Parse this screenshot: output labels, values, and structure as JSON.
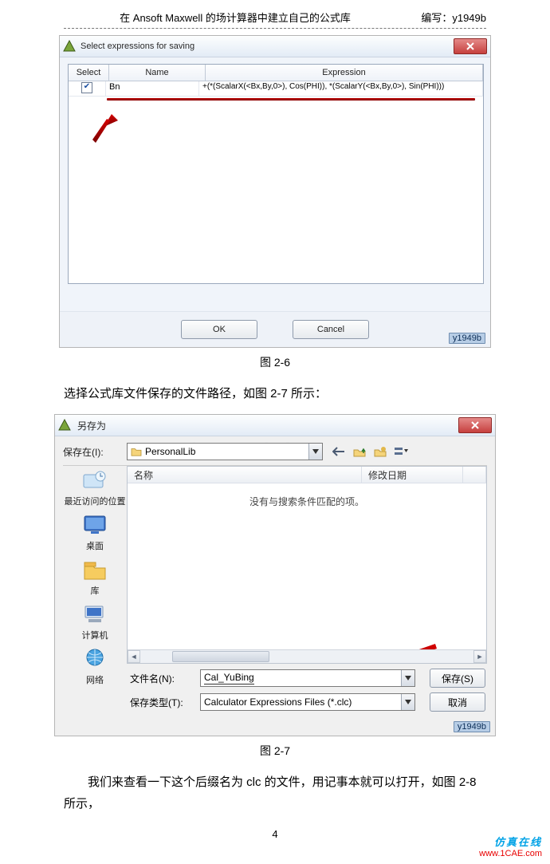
{
  "header": {
    "title": "在 Ansoft Maxwell 的场计算器中建立自己的公式库",
    "author_prefix": "编写：",
    "author": "y1949b"
  },
  "paragraphs": {
    "p1": "选择公式库文件保存的文件路径，如图 2-7 所示：",
    "p2": "我们来查看一下这个后缀名为 clc 的文件，用记事本就可以打开，如图 2-8 所示，"
  },
  "captions": {
    "fig26": "图 2-6",
    "fig27": "图 2-7"
  },
  "pagenum": "4",
  "footer": {
    "brand": "仿真在线",
    "url": "www.1CAE.com"
  },
  "watermark_faint": "1CAE.COM",
  "dialog1": {
    "title": "Select expressions for saving",
    "columns": {
      "select": "Select",
      "name": "Name",
      "expression": "Expression"
    },
    "row": {
      "checked": "✔",
      "name": "Bn",
      "expression": "+(*(ScalarX(<Bx,By,0>), Cos(PHI)), *(ScalarY(<Bx,By,0>), Sin(PHI)))"
    },
    "buttons": {
      "ok": "OK",
      "cancel": "Cancel"
    },
    "watermark": "y1949b"
  },
  "dialog2": {
    "title": "另存为",
    "save_in_label": "保存在(I):",
    "folder": "PersonalLib",
    "columns": {
      "name": "名称",
      "date": "修改日期"
    },
    "empty": "没有与搜索条件匹配的项。",
    "places": {
      "recent": "最近访问的位置",
      "desktop": "桌面",
      "library": "库",
      "computer": "计算机",
      "network": "网络"
    },
    "filename_label": "文件名(N):",
    "filename_value": "Cal_YuBing",
    "filetype_label": "保存类型(T):",
    "filetype_value": "Calculator Expressions Files (*.clc)",
    "buttons": {
      "save": "保存(S)",
      "cancel": "取消"
    },
    "watermark": "y1949b"
  }
}
